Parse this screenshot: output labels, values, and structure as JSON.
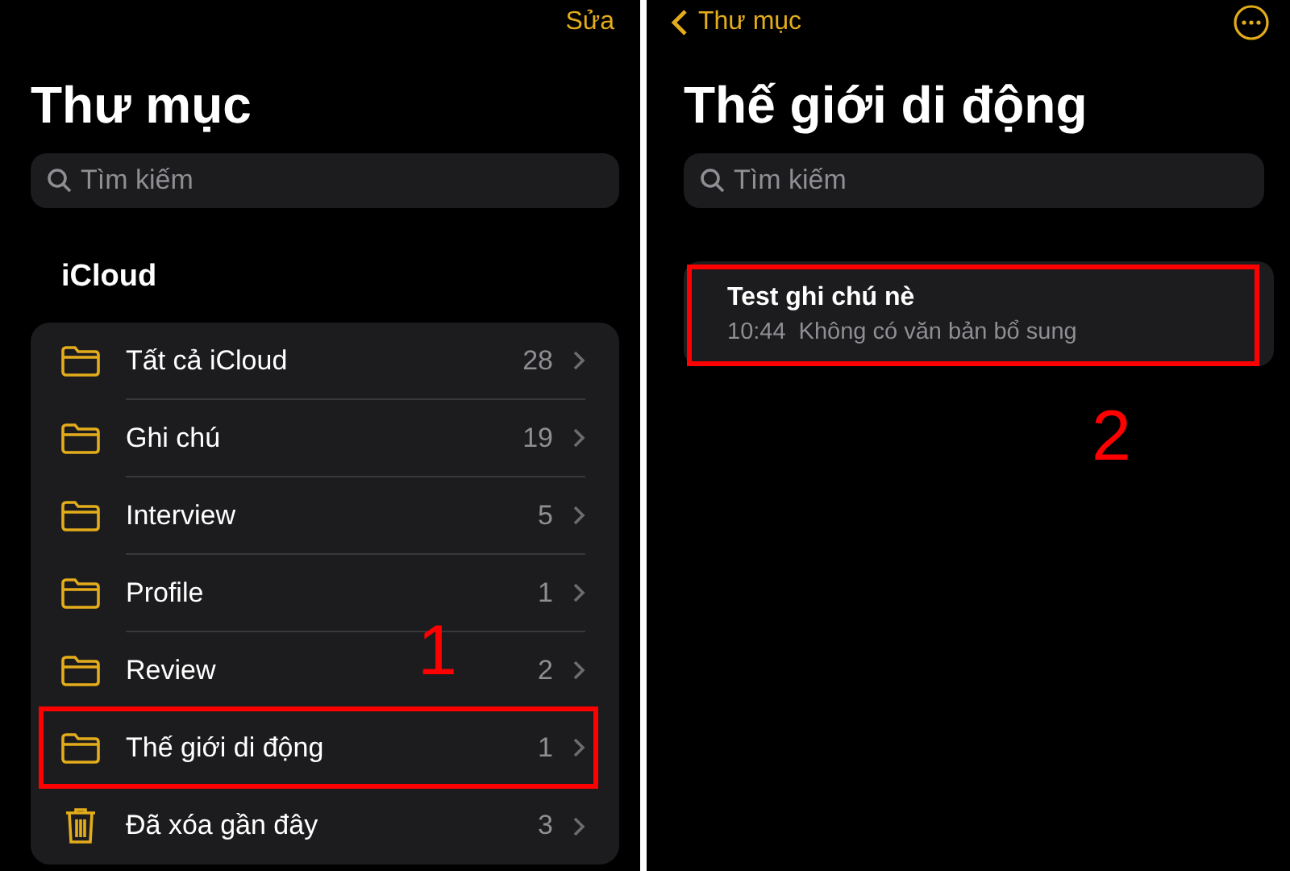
{
  "left": {
    "edit_button": "Sửa",
    "title": "Thư mục",
    "search": {
      "placeholder": "Tìm kiếm"
    },
    "section_title": "iCloud",
    "folders": [
      {
        "kind": "folder",
        "name": "Tất cả iCloud",
        "count": "28",
        "highlighted": false
      },
      {
        "kind": "folder",
        "name": "Ghi chú",
        "count": "19",
        "highlighted": false
      },
      {
        "kind": "folder",
        "name": "Interview",
        "count": "5",
        "highlighted": false
      },
      {
        "kind": "folder",
        "name": "Profile",
        "count": "1",
        "highlighted": false
      },
      {
        "kind": "folder",
        "name": "Review",
        "count": "2",
        "highlighted": false
      },
      {
        "kind": "folder",
        "name": "Thế giới di động",
        "count": "1",
        "highlighted": true
      },
      {
        "kind": "trash",
        "name": "Đã xóa gần đây",
        "count": "3",
        "highlighted": false
      }
    ],
    "step_label": "1"
  },
  "right": {
    "back_button": "Thư mục",
    "title": "Thế giới di động",
    "search": {
      "placeholder": "Tìm kiếm"
    },
    "notes": [
      {
        "title": "Test ghi chú nè",
        "time": "10:44",
        "preview": "Không có văn bản bổ sung",
        "highlighted": true
      }
    ],
    "step_label": "2"
  }
}
